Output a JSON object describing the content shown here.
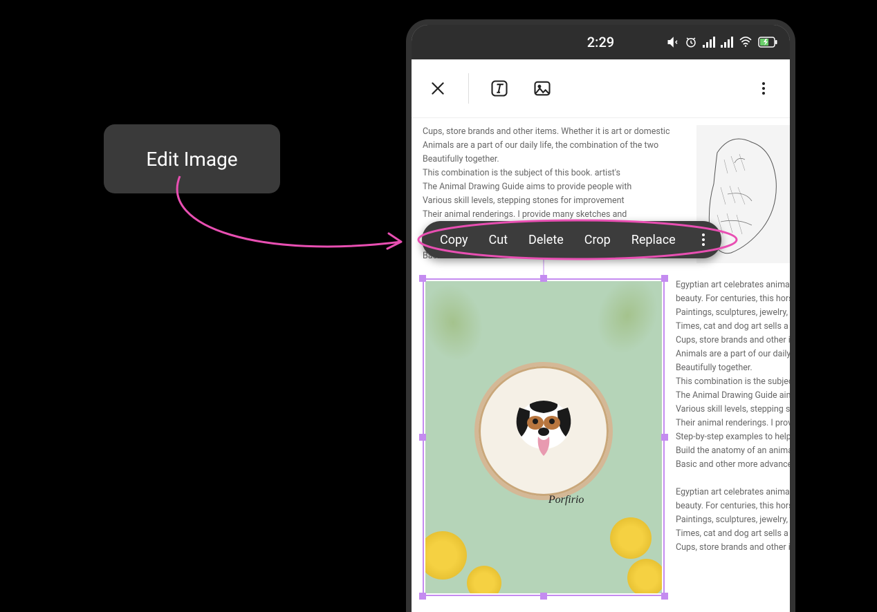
{
  "annotation": {
    "label": "Edit Image"
  },
  "status": {
    "time": "2:29"
  },
  "context_menu": {
    "copy": "Copy",
    "cut": "Cut",
    "delete": "Delete",
    "crop": "Crop",
    "replace": "Replace"
  },
  "selected_image": {
    "caption": "Porfirio"
  },
  "doc_top_lines": [
    "Cups, store brands and other items. Whether it is art or domestic",
    "Animals are a part of our daily life, the combination of the two",
    "Beautifully together.",
    "This combination is the subject of this book. artist's",
    "The Animal Drawing Guide aims to provide people with",
    "Various skill levels, stepping stones for improvement",
    "Their animal renderings. I provide many sketches and",
    "",
    "",
    "Basic and other more advanced ones. Please choose"
  ],
  "doc_right_block1": [
    "Egyptian art celebrates animal",
    "beauty. For centuries, this hors",
    "Paintings, sculptures, jewelry, a",
    "Times, cat and dog art sells a lo",
    "Cups, store brands and other it",
    "Animals are a part of our daily l",
    "Beautifully together.",
    "This combination is the subjec",
    "The Animal Drawing Guide aims",
    "Various skill levels, stepping st",
    "Their animal renderings. I prov",
    "Step-by-step examples to help",
    "Build the anatomy of an anima",
    "Basic and other more advanced"
  ],
  "doc_right_block2": [
    "Egyptian art celebrates animal",
    "beauty. For centuries, this hors",
    "Paintings, sculptures, jewelry, a",
    "Times, cat and dog art sells a lo",
    "Cups, store brands and other it"
  ]
}
